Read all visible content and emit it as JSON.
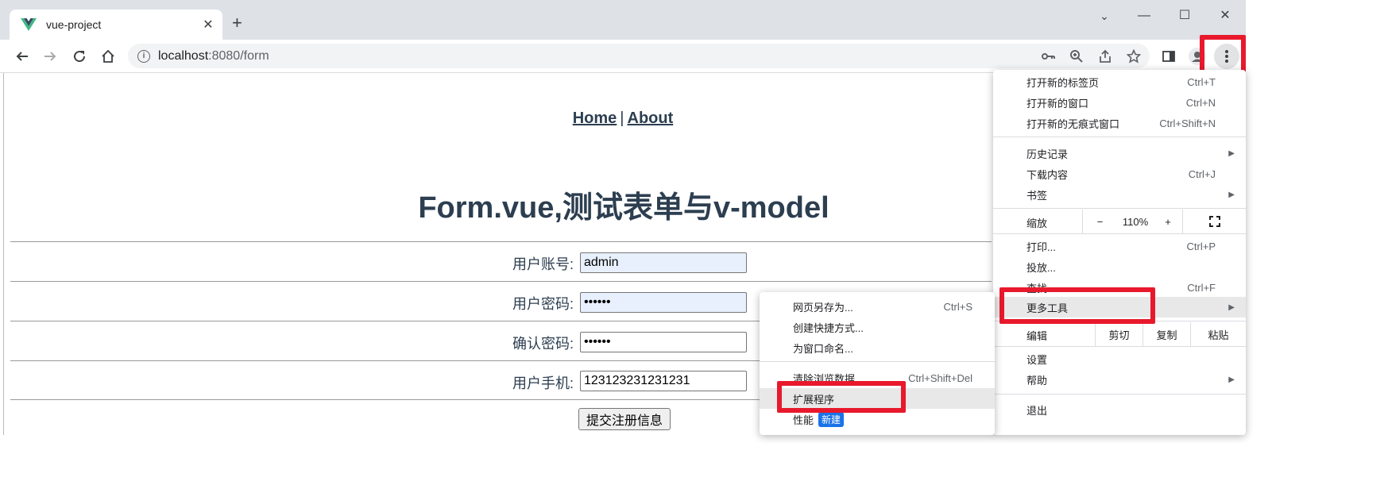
{
  "tab": {
    "title": "vue-project",
    "close": "✕",
    "new_tab": "+"
  },
  "window": {
    "chevron": "⌄",
    "minimize": "—",
    "maximize": "☐",
    "close": "✕"
  },
  "omnibox": {
    "host": "localhost",
    "path": ":8080/form"
  },
  "page": {
    "nav": {
      "home": "Home",
      "sep": "|",
      "about": "About"
    },
    "heading": "Form.vue,测试表单与v-model",
    "fields": [
      {
        "label": "用户账号:",
        "value": "admin"
      },
      {
        "label": "用户密码:",
        "value": "••••••"
      },
      {
        "label": "确认密码:",
        "value": "••••••"
      },
      {
        "label": "用户手机:",
        "value": "123123231231231"
      }
    ],
    "submit": "提交注册信息"
  },
  "menu": {
    "items": [
      {
        "label": "打开新的标签页",
        "shortcut": "Ctrl+T"
      },
      {
        "label": "打开新的窗口",
        "shortcut": "Ctrl+N"
      },
      {
        "label": "打开新的无痕式窗口",
        "shortcut": "Ctrl+Shift+N"
      },
      {
        "label": "历史记录",
        "shortcut": ""
      },
      {
        "label": "下载内容",
        "shortcut": "Ctrl+J"
      },
      {
        "label": "书签",
        "shortcut": ""
      },
      {
        "label": "打印...",
        "shortcut": "Ctrl+P"
      },
      {
        "label": "投放...",
        "shortcut": ""
      },
      {
        "label": "查找...",
        "shortcut": "Ctrl+F"
      },
      {
        "label": "更多工具",
        "shortcut": ""
      },
      {
        "label": "设置",
        "shortcut": ""
      },
      {
        "label": "帮助",
        "shortcut": ""
      },
      {
        "label": "退出",
        "shortcut": ""
      }
    ],
    "zoom": {
      "label": "缩放",
      "minus": "−",
      "value": "110%",
      "plus": "+"
    },
    "edit": {
      "label": "编辑",
      "cut": "剪切",
      "copy": "复制",
      "paste": "粘贴"
    }
  },
  "submenu": {
    "items": [
      {
        "label": "网页另存为...",
        "shortcut": "Ctrl+S"
      },
      {
        "label": "创建快捷方式...",
        "shortcut": ""
      },
      {
        "label": "为窗口命名...",
        "shortcut": ""
      },
      {
        "label": "清除浏览数据...",
        "shortcut": "Ctrl+Shift+Del"
      },
      {
        "label": "扩展程序",
        "shortcut": ""
      },
      {
        "label": "性能",
        "shortcut": "",
        "badge": "新建"
      }
    ]
  },
  "colors": {
    "accent": "#1a73e8",
    "highlight_red": "#e8192c",
    "text": "#2c3e50"
  }
}
